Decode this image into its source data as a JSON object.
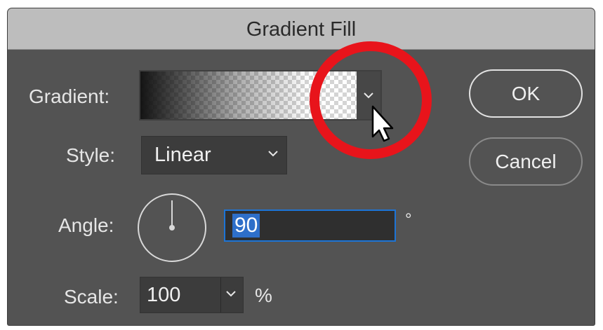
{
  "dialog": {
    "title": "Gradient Fill",
    "gradient_label": "Gradient:",
    "gradient_menu_icon": "chevron-down-icon",
    "style": {
      "label": "Style:",
      "value": "Linear"
    },
    "angle": {
      "label": "Angle:",
      "value": "90",
      "unit": "°"
    },
    "scale": {
      "label": "Scale:",
      "value": "100",
      "unit": "%"
    },
    "buttons": {
      "ok": "OK",
      "cancel": "Cancel"
    }
  },
  "annotation": {
    "circle_color": "#e8141b",
    "cursor_icon": "mouse-pointer-icon"
  },
  "colors": {
    "dialog_bg": "#535353",
    "focus_accent": "#1d74d6",
    "selection": "#2e6fc9"
  }
}
